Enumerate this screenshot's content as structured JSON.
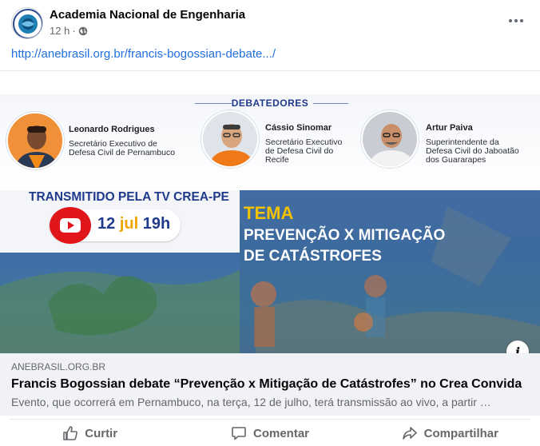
{
  "post": {
    "page_name": "Academia Nacional de Engenharia",
    "time": "12 h",
    "separator": "·",
    "privacy_icon": "globe-icon",
    "link_url": "http://anebrasil.org.br/francis-bogossian-debate.../"
  },
  "preview": {
    "debaters_title": "DEBATEDORES",
    "speakers": [
      {
        "name": "Leonardo Rodrigues",
        "role_line1": "Secretário Executivo de",
        "role_line2": "Defesa Civil de Pernambuco",
        "role_line3": ""
      },
      {
        "name": "Cássio Sinomar",
        "role_line1": "Secretário Executivo",
        "role_line2": "de Defesa Civil do",
        "role_line3": "Recife"
      },
      {
        "name": "Artur Paiva",
        "role_line1": "Superintendente da",
        "role_line2": "Defesa Civil do Jaboatão",
        "role_line3": "dos Guararapes"
      }
    ],
    "broadcast_label": "TRANSMITIDO PELA TV CREA-PE",
    "date_day": "12",
    "date_month": "jul",
    "date_time": "19h",
    "theme_label": "TEMA",
    "theme_line1": "PREVENÇÃO X MITIGAÇÃO",
    "theme_line2": "DE CATÁSTROFES",
    "info_label": "i"
  },
  "link_card": {
    "domain": "ANEBRASIL.ORG.BR",
    "title": "Francis Bogossian debate “Prevenção x Mitigação de Catástrofes” no Crea Convida",
    "description": "Evento, que ocorrerá em Pernambuco, na terça, 12 de julho, terá transmissão ao vivo, a partir …"
  },
  "actions": {
    "like": "Curtir",
    "comment": "Comentar",
    "share": "Compartilhar"
  },
  "colors": {
    "link": "#216fdb",
    "muted": "#65676b",
    "brand_blue": "#1f3a8a",
    "accent_yellow": "#f2c200",
    "youtube_red": "#e0161a"
  }
}
